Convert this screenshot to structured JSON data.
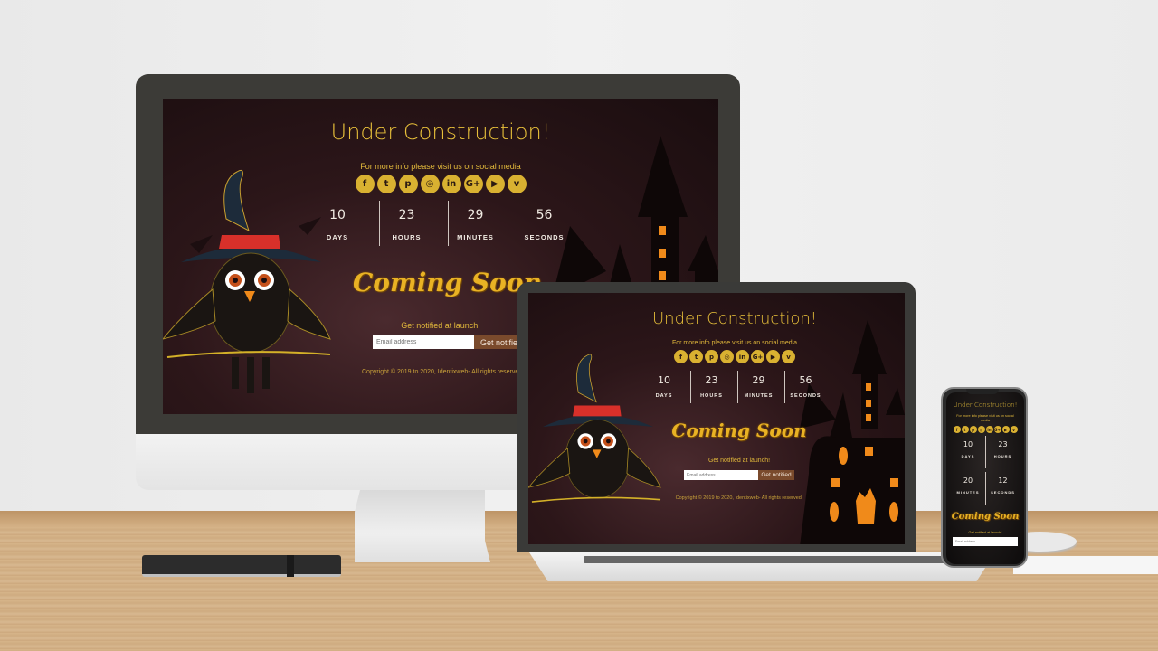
{
  "page": {
    "title": "Under Construction!",
    "subtitle": "For more info please visit us on social media",
    "social": [
      {
        "name": "facebook",
        "glyph": "f"
      },
      {
        "name": "twitter",
        "glyph": "t"
      },
      {
        "name": "pinterest",
        "glyph": "p"
      },
      {
        "name": "instagram",
        "glyph": "◎"
      },
      {
        "name": "linkedin",
        "glyph": "in"
      },
      {
        "name": "google-plus",
        "glyph": "G+"
      },
      {
        "name": "youtube",
        "glyph": "▶"
      },
      {
        "name": "vimeo",
        "glyph": "v"
      }
    ],
    "countdown": {
      "days": {
        "value": "10",
        "label": "DAYS"
      },
      "hours": {
        "value": "23",
        "label": "HOURS"
      },
      "minutes": {
        "value": "29",
        "label": "MINUTES"
      },
      "seconds": {
        "value": "56",
        "label": "SECONDS"
      }
    },
    "coming_soon": "Coming Soon",
    "notify_text": "Get notified at launch!",
    "email_placeholder": "Email address",
    "notify_button": "Get notified",
    "copyright": "Copyright © 2019 to 2020, Identixweb- All rights reserved."
  },
  "phone_page": {
    "countdown": {
      "days": {
        "value": "10",
        "label": "DAYS"
      },
      "hours": {
        "value": "23",
        "label": "HOURS"
      },
      "minutes": {
        "value": "20",
        "label": "MINUTES"
      },
      "seconds": {
        "value": "12",
        "label": "SECONDS"
      }
    }
  },
  "colors": {
    "accent_gold": "#e8c03a",
    "button_brown": "#7a4a2c",
    "background_dark": "#2c1619"
  }
}
